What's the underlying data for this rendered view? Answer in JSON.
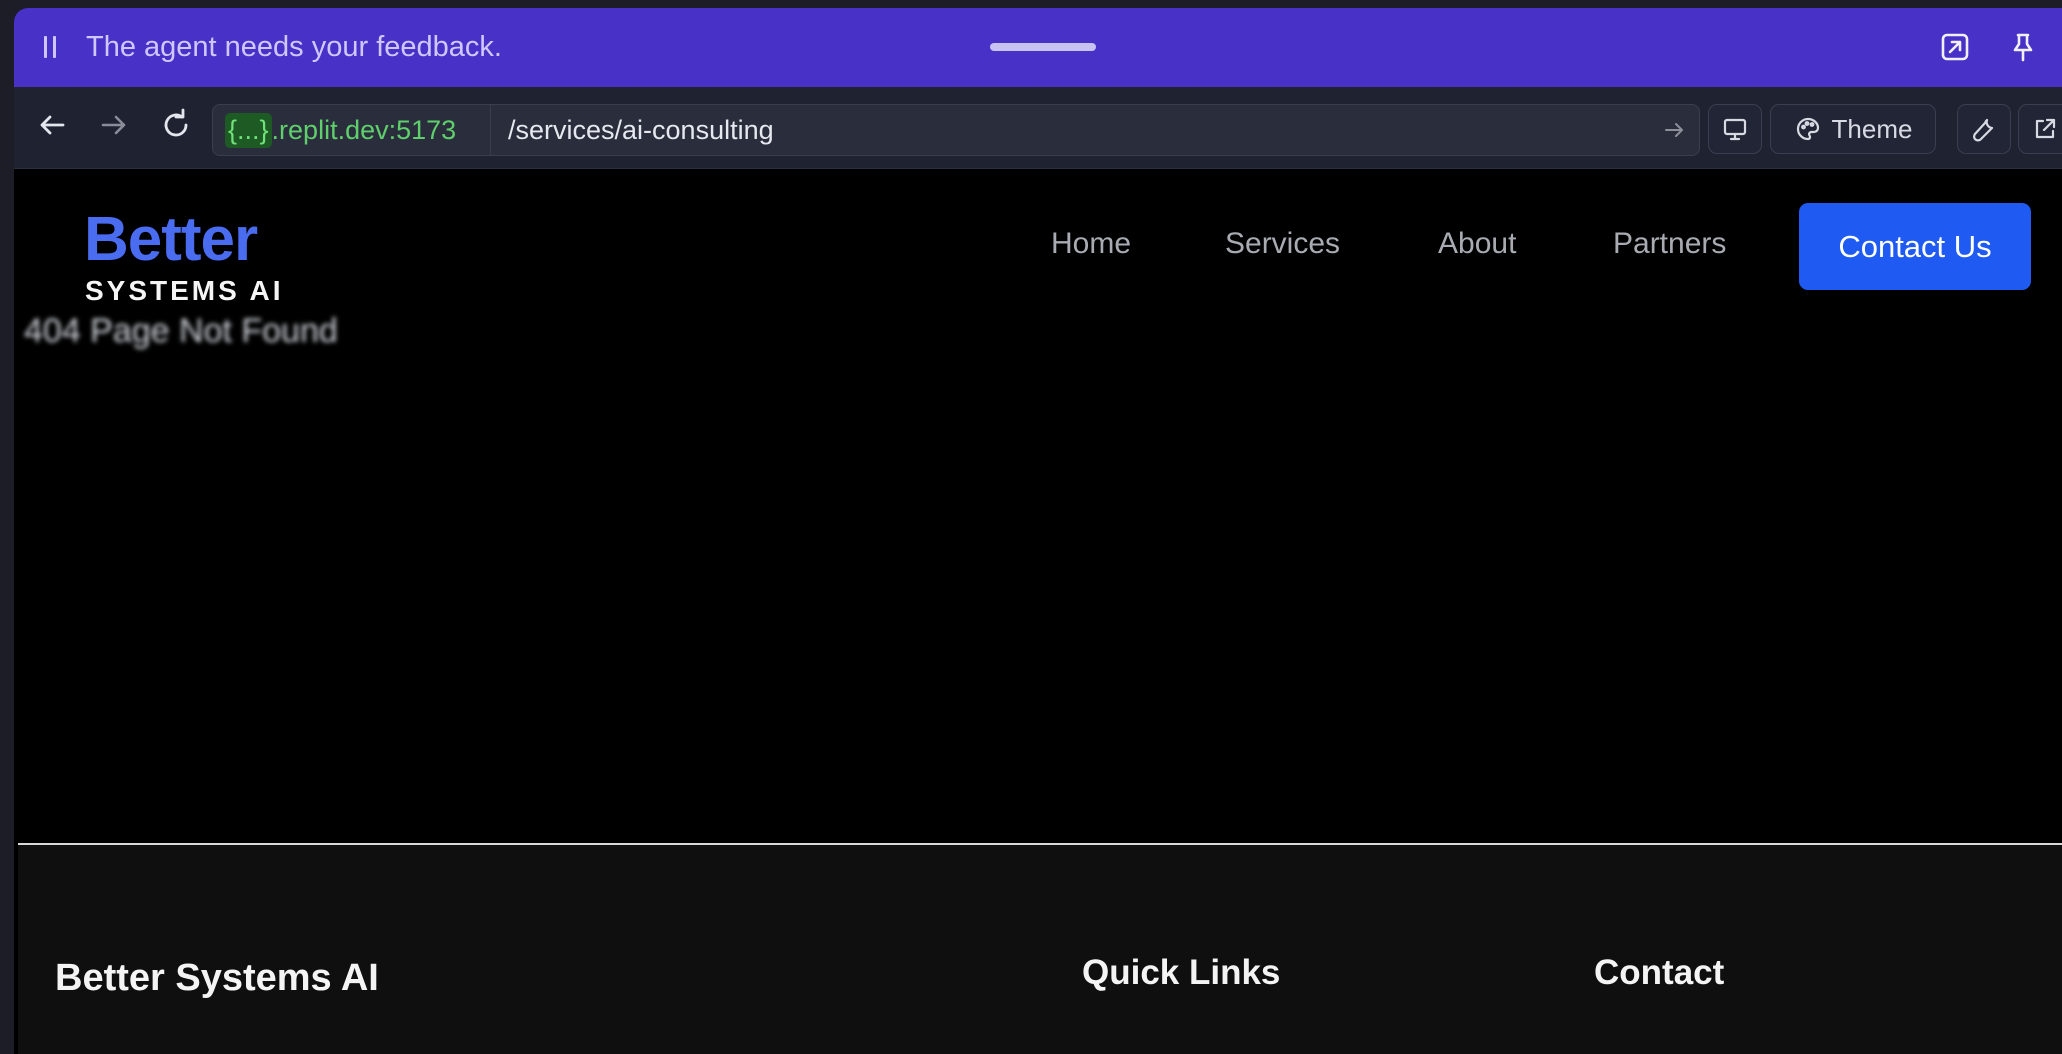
{
  "banner": {
    "message": "The agent needs your feedback."
  },
  "browser": {
    "url_host_brace": "{...}",
    "url_host_domain": ".replit.dev:5173",
    "url_path": "/services/ai-consulting",
    "theme_label": "Theme"
  },
  "site": {
    "logo_top": "Better",
    "logo_bottom": "SYSTEMS AI",
    "nav": {
      "home": "Home",
      "services": "Services",
      "about": "About",
      "partners": "Partners"
    },
    "cta": "Contact Us",
    "not_found": "404 Page Not Found"
  },
  "footer": {
    "brand": "Better Systems AI",
    "quick_links": "Quick Links",
    "contact": "Contact"
  },
  "colors": {
    "banner": "#4831c6",
    "accent": "#1f5af2",
    "logo": "#4a6cf0",
    "url_host": "#5fcf6c"
  }
}
